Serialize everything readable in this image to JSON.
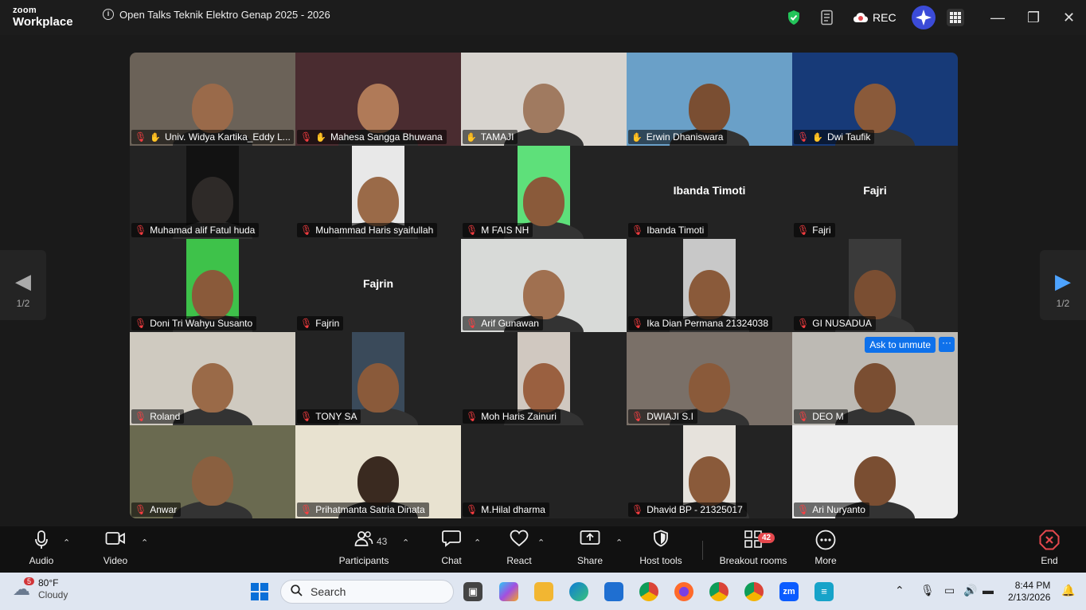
{
  "app": {
    "logo_line1": "zoom",
    "logo_line2": "Workplace",
    "meeting_title": "Open Talks Teknik Elektro Genap 2025 - 2026",
    "rec_label": "REC"
  },
  "participants": [
    {
      "name": "Univ. Widya Kartika_Eddy L...",
      "muted": true,
      "hand": true,
      "bg": "#6b6258",
      "skin": "#9a6a4a",
      "video": "full"
    },
    {
      "name": "Mahesa Sangga Bhuwana",
      "muted": true,
      "hand": true,
      "bg": "#4a2c30",
      "skin": "#b07a58",
      "video": "full"
    },
    {
      "name": "TAMAJI",
      "muted": false,
      "hand": true,
      "bg": "#d8d4cf",
      "skin": "#a07a60",
      "video": "full"
    },
    {
      "name": "Erwin Dhaniswara",
      "muted": false,
      "hand": true,
      "bg": "#6aa0c8",
      "skin": "#7a4e32",
      "video": "full",
      "active": true
    },
    {
      "name": "Dwi Taufik",
      "muted": true,
      "hand": true,
      "bg": "#173a78",
      "skin": "#8a5a3a",
      "video": "full"
    },
    {
      "name": "Muhamad alif Fatul huda",
      "muted": true,
      "hand": false,
      "bg": "#121212",
      "skin": "#2e2a28",
      "video": "narrow"
    },
    {
      "name": "Muhammad Haris syaifullah",
      "muted": true,
      "hand": false,
      "bg": "#e8e8e8",
      "skin": "#9a6a48",
      "video": "narrow"
    },
    {
      "name": "M FAIS NH",
      "muted": true,
      "hand": false,
      "bg": "#5ee07a",
      "skin": "#8a5a3a",
      "video": "narrow"
    },
    {
      "name": "Ibanda Timoti",
      "muted": true,
      "hand": false,
      "video": "none",
      "display": "Ibanda Timoti"
    },
    {
      "name": "Fajri",
      "muted": true,
      "hand": false,
      "video": "none",
      "display": "Fajri"
    },
    {
      "name": "Doni Tri Wahyu Susanto",
      "muted": true,
      "hand": false,
      "bg": "#3ec24a",
      "skin": "#8a5a3a",
      "video": "narrow"
    },
    {
      "name": "Fajrin",
      "muted": true,
      "hand": false,
      "video": "none",
      "display": "Fajrin"
    },
    {
      "name": "Arif Gunawan",
      "muted": true,
      "hand": false,
      "bg": "#d8dad8",
      "skin": "#a07050",
      "video": "full"
    },
    {
      "name": "Ika Dian Permana 21324038",
      "muted": true,
      "hand": false,
      "bg": "#c8c8c8",
      "skin": "#8a5a3a",
      "video": "narrow"
    },
    {
      "name": "GI NUSADUA",
      "muted": true,
      "hand": false,
      "bg": "#3a3a3a",
      "skin": "#7a4e32",
      "video": "narrow"
    },
    {
      "name": "Roland",
      "muted": true,
      "hand": false,
      "bg": "#cfcac0",
      "skin": "#9a6a48",
      "video": "full"
    },
    {
      "name": "TONY SA",
      "muted": true,
      "hand": false,
      "bg": "#3a4a5a",
      "skin": "#8a5a3a",
      "video": "narrow"
    },
    {
      "name": "Moh Haris Zainuri",
      "muted": true,
      "hand": false,
      "bg": "#d0c8c0",
      "skin": "#9a6040",
      "video": "narrow"
    },
    {
      "name": "DWIAJI S.I",
      "muted": true,
      "hand": false,
      "bg": "#7a7068",
      "skin": "#8a5a3a",
      "video": "full"
    },
    {
      "name": "DEO M",
      "muted": true,
      "hand": false,
      "bg": "#bdbab4",
      "skin": "#7a4e32",
      "video": "full",
      "ask_unmute": true
    },
    {
      "name": "Anwar",
      "muted": true,
      "hand": false,
      "bg": "#6a6a50",
      "skin": "#8a6040",
      "video": "full"
    },
    {
      "name": "Prihatmanta Satria Dinata",
      "muted": true,
      "hand": false,
      "bg": "#e8e2d0",
      "skin": "#3a2a20",
      "video": "full"
    },
    {
      "name": "M.Hilal dharma",
      "muted": true,
      "hand": false,
      "video": "none",
      "display": ""
    },
    {
      "name": "Dhavid BP - 21325017",
      "muted": true,
      "hand": false,
      "bg": "#e6e2dc",
      "skin": "#8a5a3a",
      "video": "narrow"
    },
    {
      "name": "Ari Nuryanto",
      "muted": true,
      "hand": false,
      "bg": "#eeeeee",
      "skin": "#7a4e32",
      "video": "full"
    }
  ],
  "tile_overlay": {
    "ask_unmute_label": "Ask to unmute",
    "more_label": "···"
  },
  "pager": {
    "left_page": "1/2",
    "right_page": "1/2"
  },
  "toolbar": {
    "audio": "Audio",
    "video": "Video",
    "participants": "Participants",
    "participants_count": "43",
    "chat": "Chat",
    "react": "React",
    "share": "Share",
    "host_tools": "Host tools",
    "breakout_rooms": "Breakout rooms",
    "breakout_badge": "42",
    "more": "More",
    "end": "End"
  },
  "taskbar": {
    "weather_badge": "5",
    "temperature": "80°F",
    "condition": "Cloudy",
    "search_placeholder": "Search",
    "time": "8:44 PM",
    "date": "2/13/2026"
  },
  "colors": {
    "active_speaker": "#23d96b",
    "muted": "#e5484d",
    "accent": "#0e71eb"
  }
}
